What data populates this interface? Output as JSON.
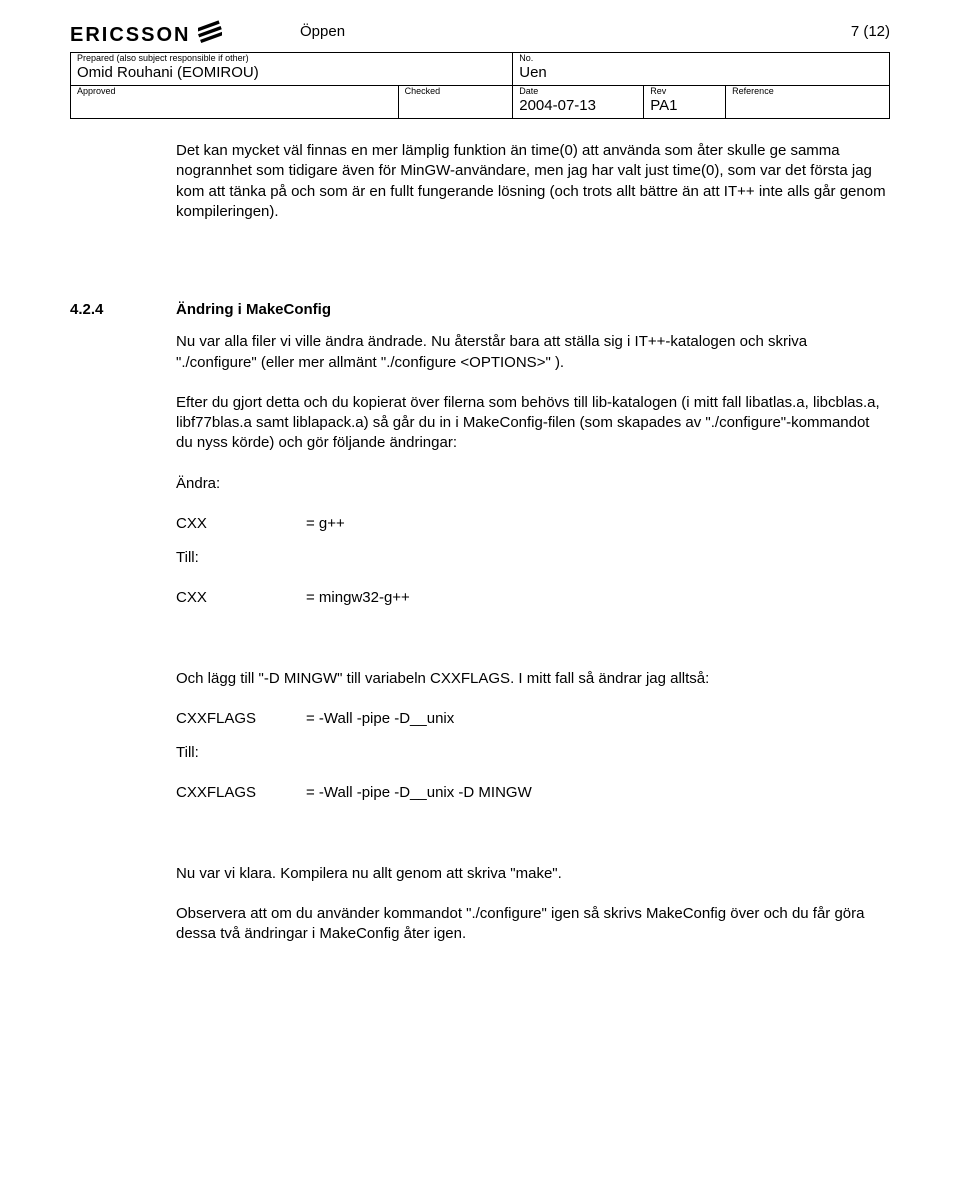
{
  "header": {
    "logo_text": "ERICSSON",
    "classification": "Öppen",
    "page_number": "7 (12)"
  },
  "meta": {
    "prepared_label": "Prepared (also subject responsible if other)",
    "prepared_value": "Omid Rouhani (EOMIROU)",
    "no_label": "No.",
    "no_value": "Uen",
    "approved_label": "Approved",
    "approved_value": "",
    "checked_label": "Checked",
    "checked_value": "",
    "date_label": "Date",
    "date_value": "2004-07-13",
    "rev_label": "Rev",
    "rev_value": "PA1",
    "reference_label": "Reference",
    "reference_value": ""
  },
  "body": {
    "intro_para": "Det kan mycket väl finnas en mer lämplig funktion än time(0) att använda som åter skulle ge samma nogrannhet som tidigare även för MinGW-användare, men jag har valt just time(0), som var det första jag kom att tänka på och som är en fullt fungerande lösning (och trots allt bättre än att IT++ inte alls går genom kompileringen).",
    "section_num": "4.2.4",
    "section_title": "Ändring i MakeConfig",
    "p1": "Nu var alla filer vi ville ändra ändrade. Nu återstår bara att ställa sig i IT++-katalogen och skriva \"./configure\" (eller mer allmänt \"./configure <OPTIONS>\" ).",
    "p2": "Efter du gjort detta och du kopierat över filerna som behövs till lib-katalogen (i mitt fall libatlas.a, libcblas.a, libf77blas.a samt liblapack.a) så går du in i MakeConfig-filen (som skapades av \"./configure\"-kommandot du nyss körde) och gör följande ändringar:",
    "andra": "Ändra:",
    "cxx_label1": "CXX",
    "cxx_val1": "= g++",
    "till": "Till:",
    "cxx_label2": "CXX",
    "cxx_val2": "= mingw32-g++",
    "p3": "Och lägg till \"-D MINGW\" till variabeln CXXFLAGS. I mitt fall så ändrar jag alltså:",
    "flags_label1": "CXXFLAGS",
    "flags_val1": "= -Wall -pipe -D__unix",
    "flags_label2": "CXXFLAGS",
    "flags_val2": "= -Wall -pipe -D__unix -D MINGW",
    "p4": "Nu var vi klara. Kompilera nu allt genom att skriva \"make\".",
    "p5": "Observera att om du använder kommandot \"./configure\" igen så skrivs MakeConfig över och du får göra dessa två ändringar i MakeConfig åter igen."
  }
}
